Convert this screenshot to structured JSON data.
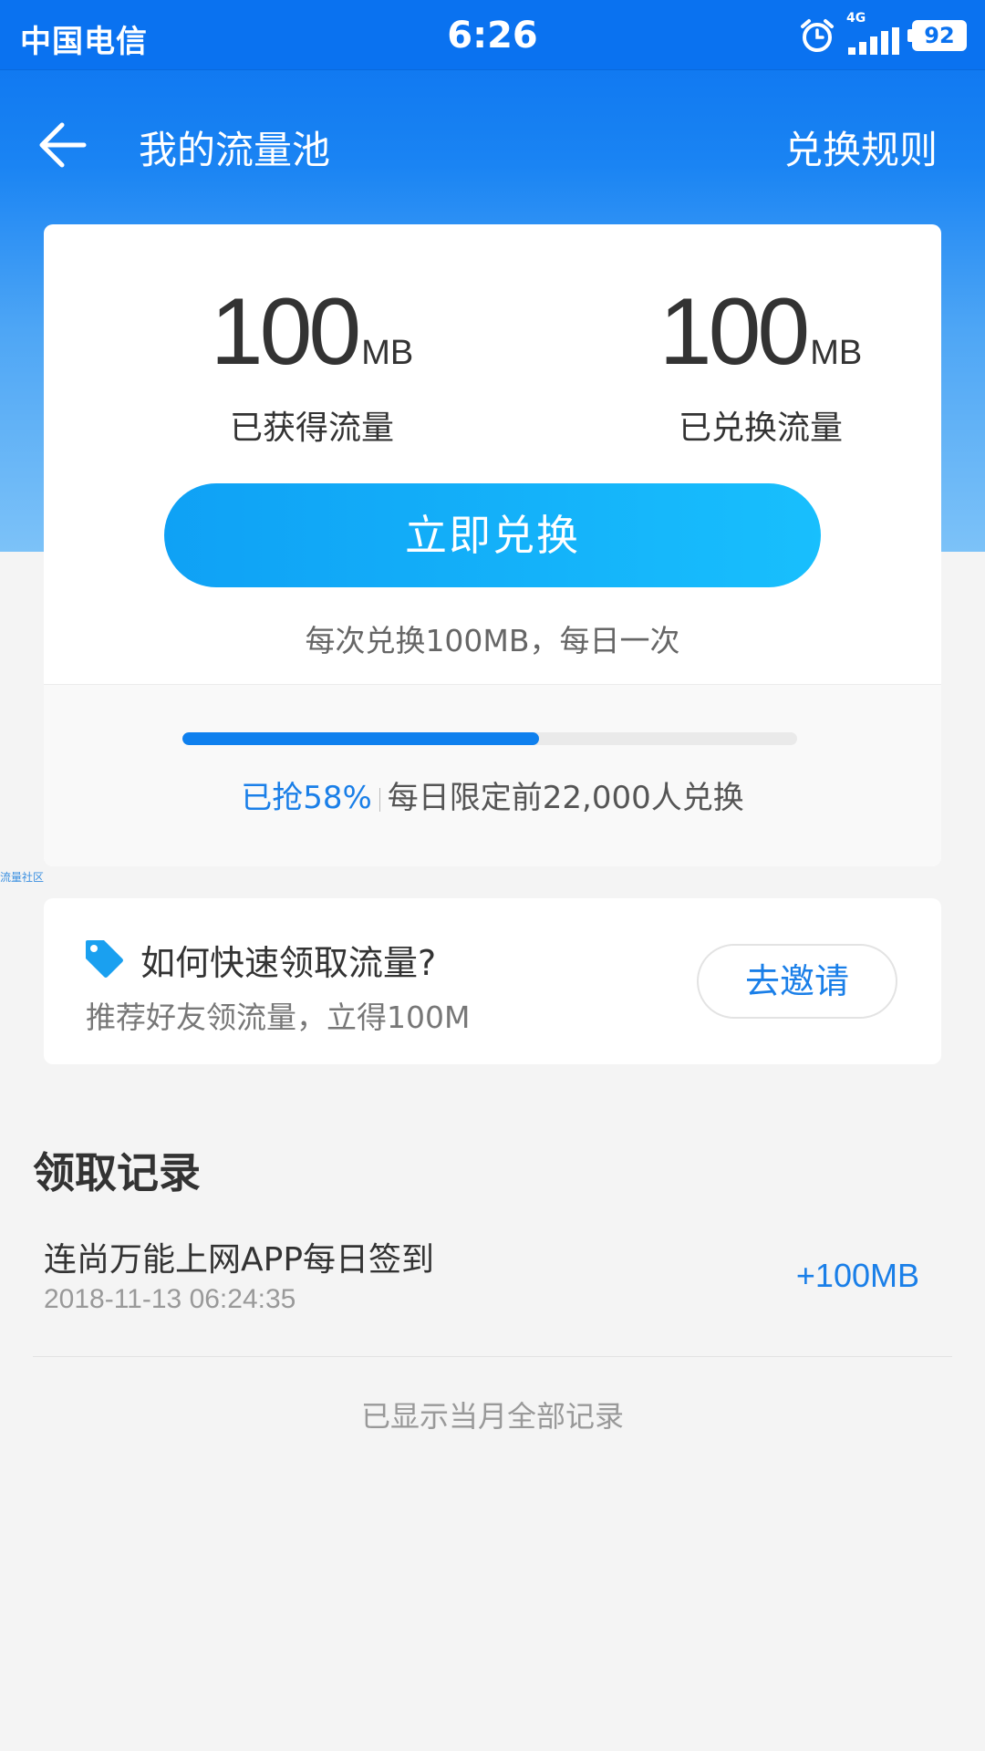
{
  "status_bar": {
    "carrier": "中国电信",
    "time": "6:26",
    "network": "4G",
    "battery": "92"
  },
  "nav": {
    "title": "我的流量池",
    "rules_link": "兑换规则"
  },
  "summary": {
    "earned": {
      "value": "100",
      "unit": "MB",
      "label": "已获得流量"
    },
    "redeemed": {
      "value": "100",
      "unit": "MB",
      "label": "已兑换流量"
    },
    "redeem_button": "立即兑换",
    "redeem_note": "每次兑换100MB，每日一次"
  },
  "progress": {
    "percent": 58,
    "grabbed_text": "已抢58%",
    "limit_text": "每日限定前22,000人兑换"
  },
  "watermark": "流量社区",
  "invite": {
    "title": "如何快速领取流量?",
    "subtitle": "推荐好友领流量，立得100M",
    "button": "去邀请"
  },
  "records": {
    "heading": "领取记录",
    "items": [
      {
        "name": "连尚万能上网APP每日签到",
        "time": "2018-11-13 06:24:35",
        "amount": "+100MB"
      }
    ],
    "end_text": "已显示当月全部记录"
  },
  "colors": {
    "primary": "#0a72f0",
    "accent_blue": "#1a7fe8",
    "button_gradient_start": "#0fa1f5",
    "button_gradient_end": "#18bffd"
  }
}
